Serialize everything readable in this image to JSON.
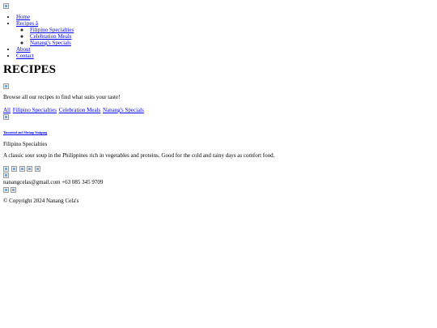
{
  "nav": {
    "items": [
      {
        "label": "Home"
      },
      {
        "label": "Recipes â",
        "children": [
          {
            "label": "Filipino Specialties"
          },
          {
            "label": "Celebration Meals"
          },
          {
            "label": "Nanang's Specials"
          }
        ]
      },
      {
        "label": "About"
      },
      {
        "label": "Contact"
      }
    ]
  },
  "page": {
    "title": "RECIPES",
    "intro": "Browse all our recipes to find what suits your taste!"
  },
  "filters": [
    "All",
    "Filipino Specialties",
    "Celebration Meals",
    "Nanang's Specials"
  ],
  "recipe": {
    "title": "Tamarind and Shrimp Sinigang",
    "category": "Filipino Specialties",
    "description": "A classic sour soup in the Philippines rich in vegetables and proteins. Good for the cold and rainy days as comfort food."
  },
  "footer": {
    "email": "nanangcelas@gmail.com",
    "phone": "+63 085 345 9709",
    "copyright": "© Copyright 2024 Nanang Cela's"
  }
}
